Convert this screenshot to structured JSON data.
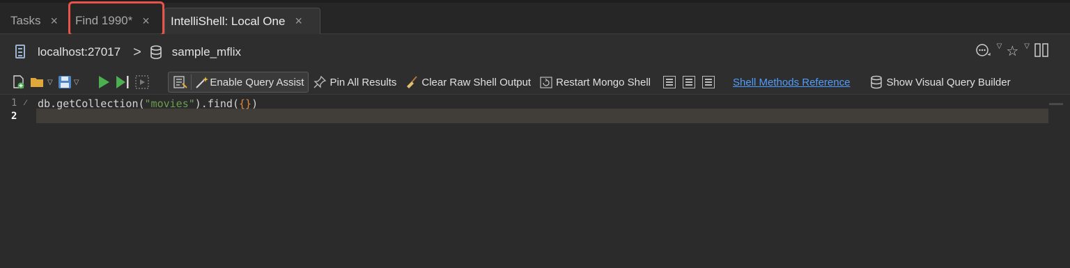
{
  "tabs": [
    {
      "label": "Tasks",
      "close": "×"
    },
    {
      "label": "Find 1990*",
      "close": "×"
    },
    {
      "label": "IntelliShell: Local One",
      "close": "×"
    }
  ],
  "breadcrumb": {
    "server": "localhost:27017",
    "separator": ">",
    "database": "sample_mflix"
  },
  "toolbar": {
    "enable_query_assist": "Enable Query Assist",
    "pin_all_results": "Pin All Results",
    "clear_raw_shell_output": "Clear Raw Shell Output",
    "restart_mongo_shell": "Restart Mongo Shell",
    "shell_methods_reference": "Shell Methods Reference",
    "show_visual_query_builder": "Show Visual Query Builder"
  },
  "editor": {
    "line_numbers": [
      "1",
      "2"
    ],
    "code_prefix": "db.getCollection(",
    "code_string": "\"movies\"",
    "code_mid": ").find(",
    "code_braces": "{}",
    "code_suffix": ")"
  },
  "colors": {
    "highlight": "#e8534a",
    "link": "#4f9dff",
    "run": "#4caf50"
  }
}
